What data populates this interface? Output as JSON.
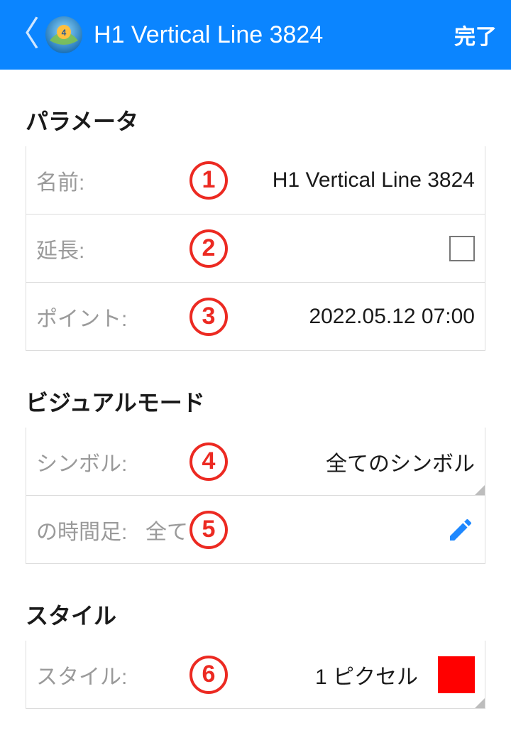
{
  "header": {
    "title": "H1 Vertical Line 3824",
    "done": "完了"
  },
  "sections": {
    "parameters": {
      "title": "パラメータ",
      "name_label": "名前:",
      "name_value": "H1 Vertical Line 3824",
      "extend_label": "延長:",
      "extend_checked": false,
      "point_label": "ポイント:",
      "point_value": "2022.05.12 07:00"
    },
    "visual": {
      "title": "ビジュアルモード",
      "symbol_label": "シンボル:",
      "symbol_value": "全てのシンボル",
      "timeframe_label": "の時間足:",
      "timeframe_value": "全て"
    },
    "style": {
      "title": "スタイル",
      "style_label": "スタイル:",
      "style_value": "1 ピクセル",
      "color": "#ff0000"
    }
  },
  "annotations": [
    "1",
    "2",
    "3",
    "4",
    "5",
    "6"
  ]
}
